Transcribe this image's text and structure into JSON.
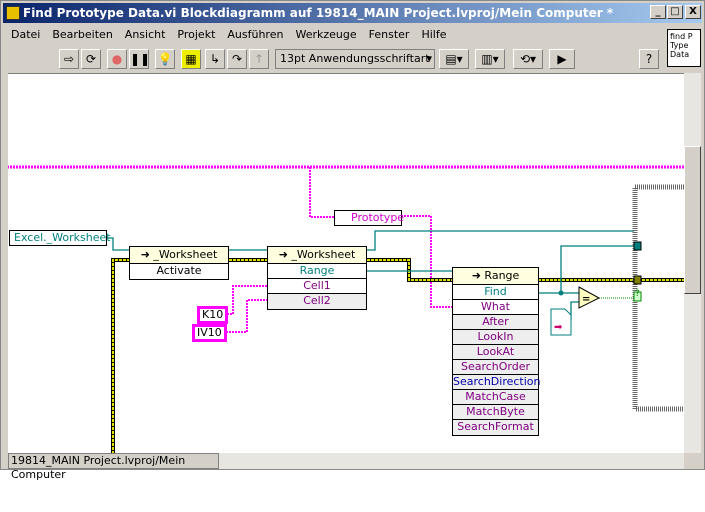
{
  "window": {
    "title": "Find Prototype Data.vi Blockdiagramm auf 19814_MAIN Project.lvproj/Mein Computer *",
    "minimize": "_",
    "maximize": "□",
    "close": "X"
  },
  "menu": [
    "Datei",
    "Bearbeiten",
    "Ansicht",
    "Projekt",
    "Ausführen",
    "Werkzeuge",
    "Fenster",
    "Hilfe"
  ],
  "toolbar": {
    "font": "13pt Anwendungsschriftart",
    "help": "?"
  },
  "vi_icon": {
    "text": "find P Type Data"
  },
  "diagram": {
    "control": "Excel._Worksheet",
    "node1": {
      "header": "_Worksheet",
      "rows": [
        "Activate"
      ]
    },
    "node2": {
      "header": "_Worksheet",
      "rows": [
        "Range",
        "Cell1",
        "Cell2"
      ]
    },
    "node3": {
      "header": "Range",
      "rows": [
        "Find",
        "What",
        "After",
        "LookIn",
        "LookAt",
        "SearchOrder",
        "SearchDirection",
        "MatchCase",
        "MatchByte",
        "SearchFormat"
      ]
    },
    "constants": {
      "k10": "K10",
      "iv10": "IV10",
      "prototype": "Prototype"
    },
    "compare": "=",
    "case_selector": "?"
  },
  "status": {
    "path": "19814_MAIN Project.lvproj/Mein Computer"
  },
  "colors": {
    "string_wire": "#ff00ff",
    "refnum_wire": "#007f7f",
    "error_wire": "#e0e000",
    "title_bar": "#0a246a"
  }
}
